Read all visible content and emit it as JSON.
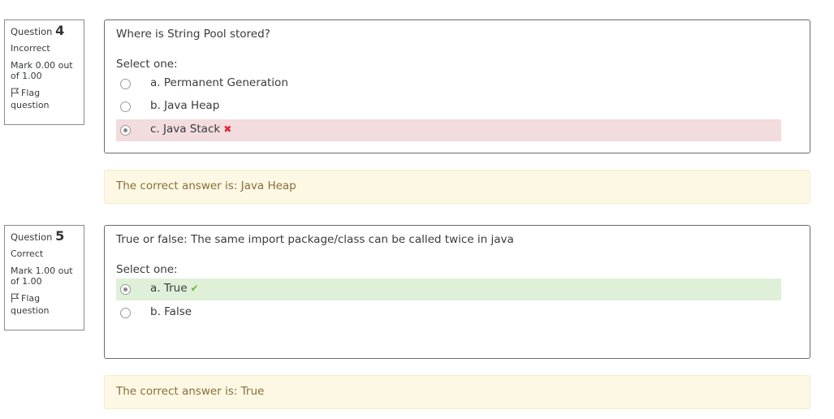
{
  "questions": [
    {
      "label": "Question",
      "number": "4",
      "state": "Incorrect",
      "grade": "Mark 0.00 out of 1.00",
      "flag_label": "Flag question",
      "text": "Where is String Pool stored?",
      "prompt": "Select one:",
      "options": [
        {
          "label": "a. Permanent Generation"
        },
        {
          "label": "b. Java Heap"
        },
        {
          "label": "c. Java Stack",
          "selected": true,
          "result": "incorrect"
        }
      ],
      "feedback": "The correct answer is: Java Heap"
    },
    {
      "label": "Question",
      "number": "5",
      "state": "Correct",
      "grade": "Mark 1.00 out of 1.00",
      "flag_label": "Flag question",
      "text": "True or false: The same import package/class can be called twice in java",
      "prompt": "Select one:",
      "options": [
        {
          "label": "a. True",
          "selected": true,
          "result": "correct"
        },
        {
          "label": "b. False"
        }
      ],
      "feedback": "The correct answer is: True"
    }
  ],
  "icons": {
    "flag": "flag-icon",
    "incorrect_mark": "cross-icon",
    "correct_mark": "check-icon"
  },
  "colors": {
    "incorrect_bg": "#f2dcde",
    "correct_bg": "#dff0d8",
    "feedback_bg": "#fcf8e3",
    "feedback_text": "#8a6d3b",
    "cross": "#e3262f",
    "check": "#6fb33e"
  }
}
